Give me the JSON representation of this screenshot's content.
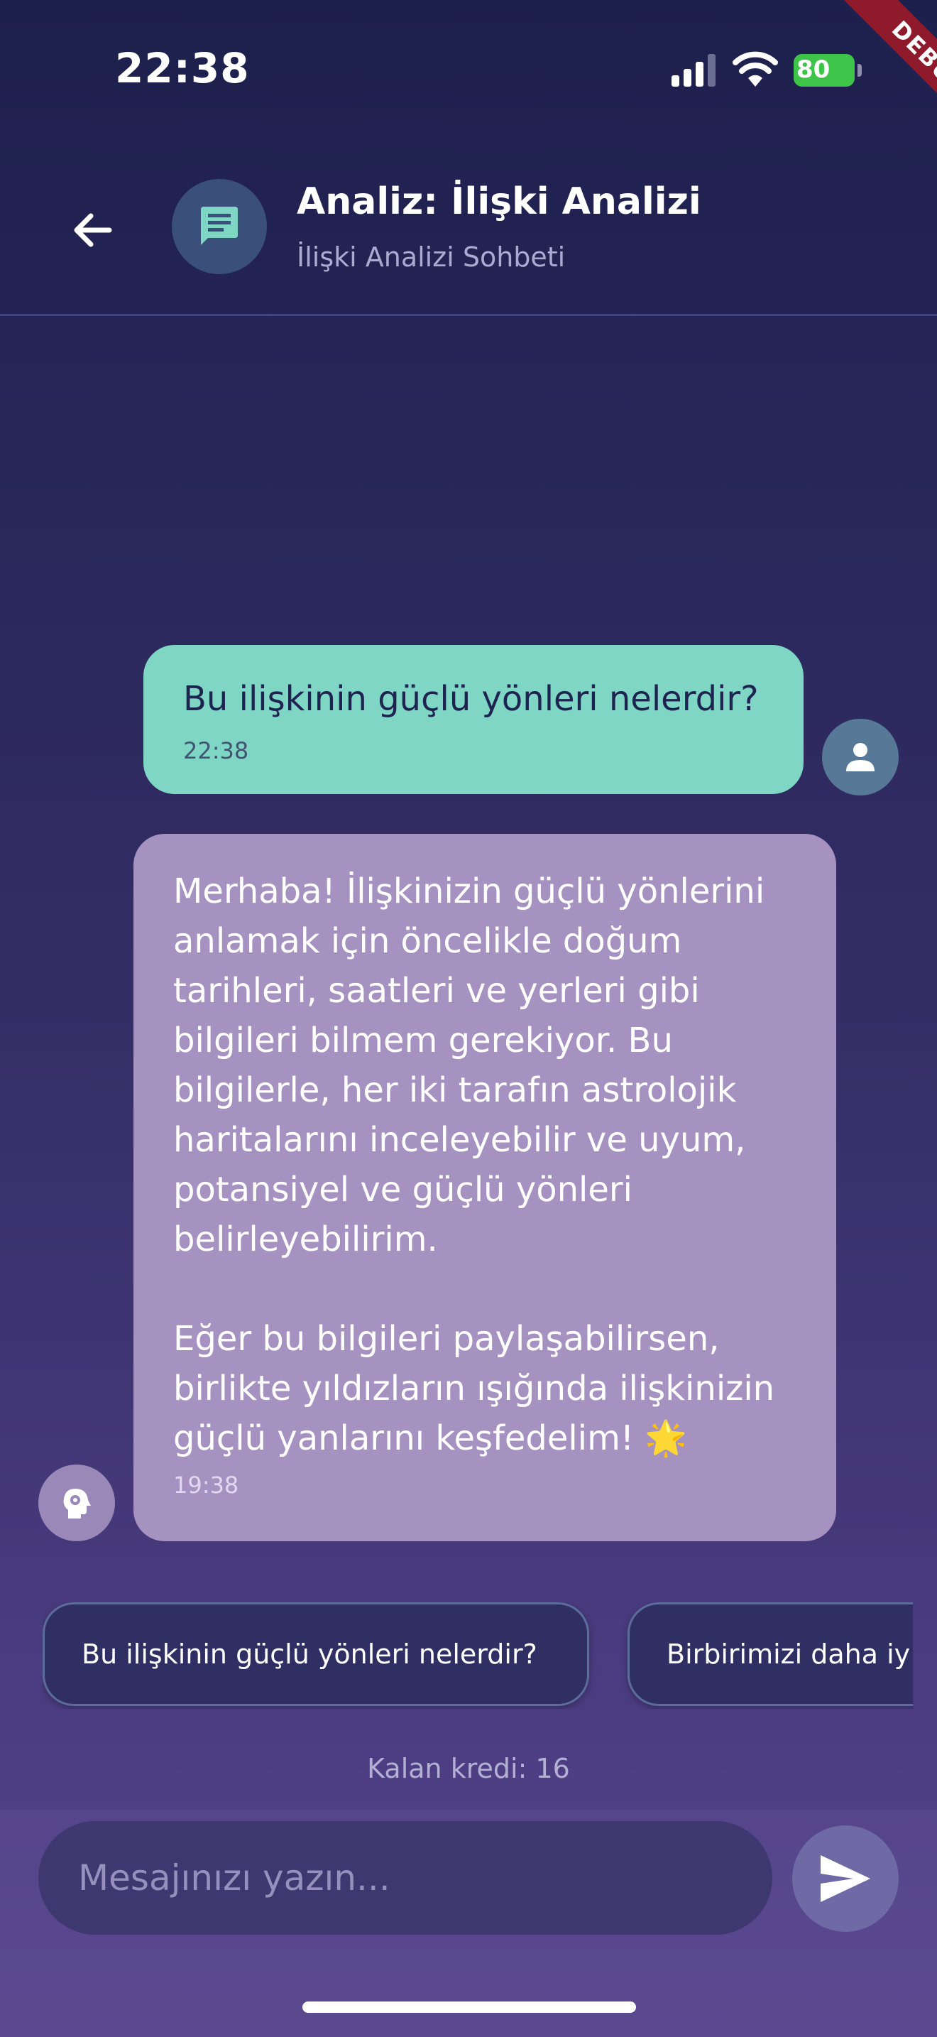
{
  "status_bar": {
    "time": "22:38",
    "battery": "80",
    "icons": [
      "signal-icon",
      "wifi-icon",
      "battery-icon"
    ],
    "debug_label": "DEBUG"
  },
  "header": {
    "title": "Analiz: İlişki Analizi",
    "subtitle": "İlişki Analizi Sohbeti",
    "icons": [
      "back-arrow-icon",
      "chat-bubble-icon"
    ]
  },
  "messages": [
    {
      "sender": "user",
      "text": "Bu ilişkinin güçlü yönleri nelerdir?",
      "time": "22:38",
      "avatar_icon": "person-icon"
    },
    {
      "sender": "assistant",
      "text": "Merhaba! İlişkinizin güçlü yönlerini anlamak için öncelikle doğum tarihleri, saatleri ve yerleri gibi bilgileri bilmem gerekiyor. Bu bilgilerle, her iki tarafın astrolojik haritalarını inceleyebilir ve uyum, potansiyel ve güçlü yönleri belirleyebilirim.\n\nEğer bu bilgileri paylaşabilirsen, birlikte yıldızların ışığında ilişkinizin güçlü yanlarını keşfedelim! 🌟",
      "time": "19:38",
      "avatar_icon": "psychology-head-icon"
    }
  ],
  "suggestions": [
    "Bu ilişkinin güçlü yönleri nelerdir?",
    "Birbirimizi daha iy"
  ],
  "credits": "Kalan kredi: 16",
  "input": {
    "placeholder": "Mesajınızı yazın...",
    "value": ""
  },
  "colors": {
    "user_bubble": "#7fd6c5",
    "assistant_bubble": "#a692c0",
    "background_top": "#1d1f4c",
    "background_bottom": "#57468e",
    "battery": "#3fc44a"
  }
}
